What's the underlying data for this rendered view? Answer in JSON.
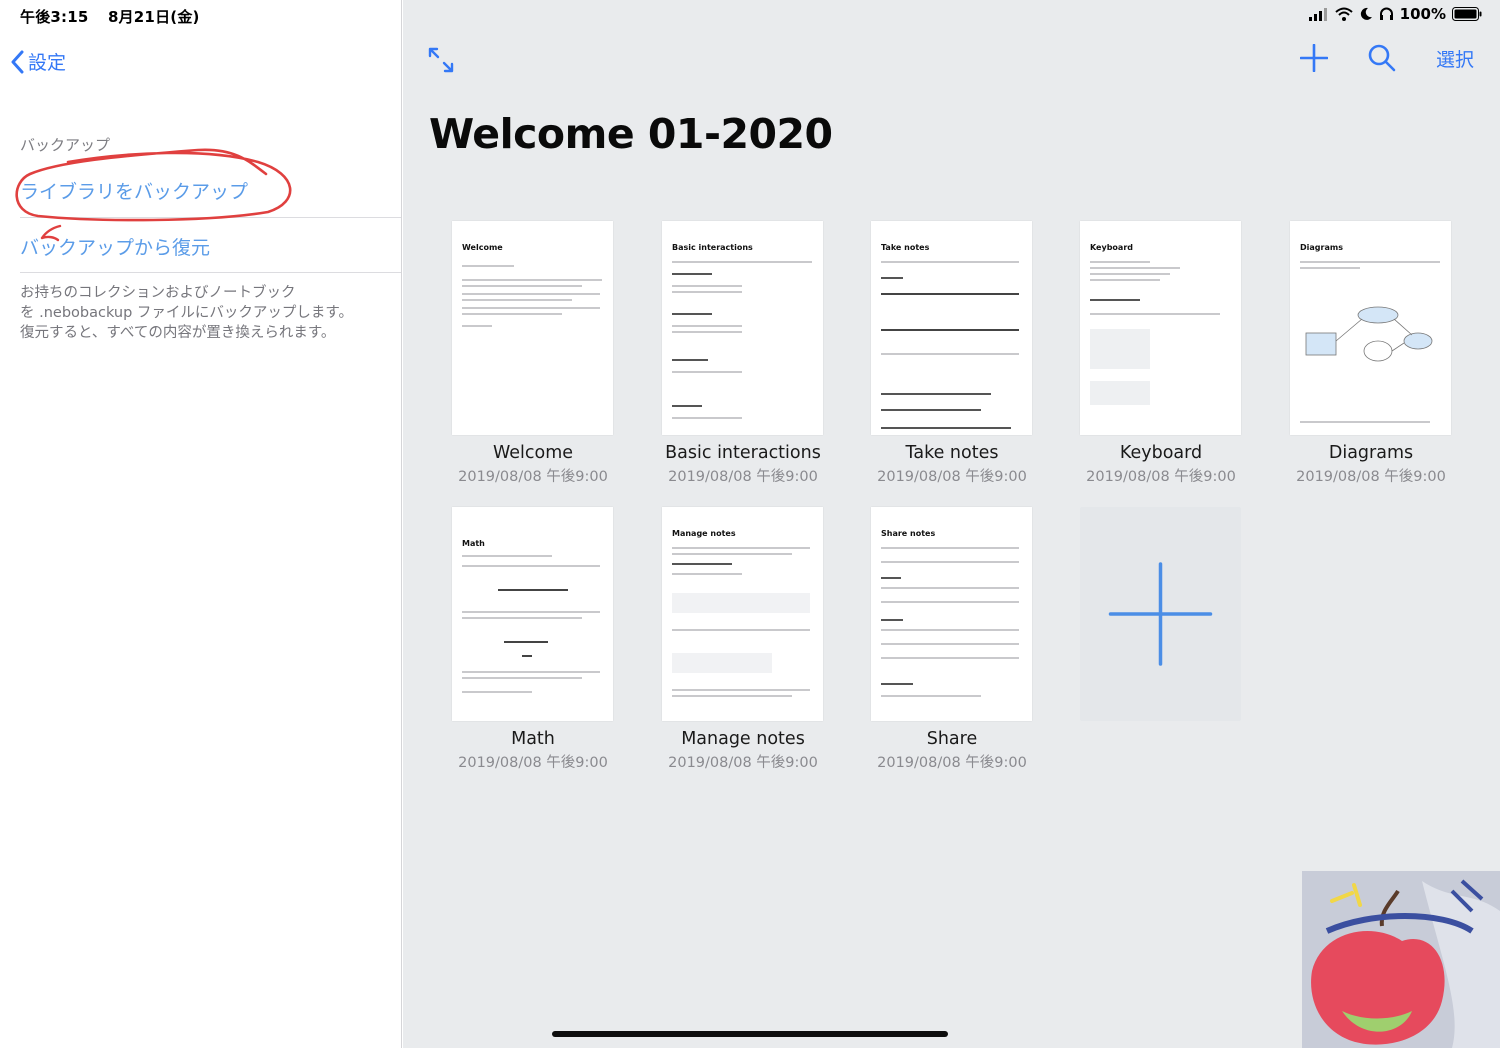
{
  "status_bar": {
    "time": "午後3:15",
    "date": "8月21日(金)",
    "battery": "100%"
  },
  "left_pane": {
    "back_label": "設定",
    "section_header": "バックアップ",
    "backup_label": "ライブラリをバックアップ",
    "restore_label": "バックアップから復元",
    "footer_lines": [
      "お持ちのコレクションおよびノートブック",
      "を .nebobackup ファイルにバックアップします。",
      "復元すると、すべての内容が置き換えられます。"
    ]
  },
  "main": {
    "title": "Welcome 01-2020",
    "select_label": "選択",
    "notes": [
      {
        "name": "Welcome",
        "date": "2019/08/08 午後9:00",
        "thumb_title": "Welcome"
      },
      {
        "name": "Basic interactions",
        "date": "2019/08/08 午後9:00",
        "thumb_title": "Basic interactions"
      },
      {
        "name": "Take notes",
        "date": "2019/08/08 午後9:00",
        "thumb_title": "Take notes"
      },
      {
        "name": "Keyboard",
        "date": "2019/08/08 午後9:00",
        "thumb_title": "Keyboard"
      },
      {
        "name": "Diagrams",
        "date": "2019/08/08 午後9:00",
        "thumb_title": "Diagrams"
      },
      {
        "name": "Math",
        "date": "2019/08/08 午後9:00",
        "thumb_title": "Math"
      },
      {
        "name": "Manage notes",
        "date": "2019/08/08 午後9:00",
        "thumb_title": "Manage notes"
      },
      {
        "name": "Share",
        "date": "2019/08/08 午後9:00",
        "thumb_title": "Share notes"
      }
    ]
  },
  "colors": {
    "accent": "#3478f6",
    "link_light": "#5b9ce8",
    "annotation_red": "#e0403f",
    "main_bg": "#e9ebed"
  },
  "icons": [
    "chevron-left-icon",
    "expand-icon",
    "plus-icon",
    "search-icon",
    "signal-icon",
    "wifi-icon",
    "moon-icon",
    "headphones-icon",
    "battery-icon"
  ]
}
